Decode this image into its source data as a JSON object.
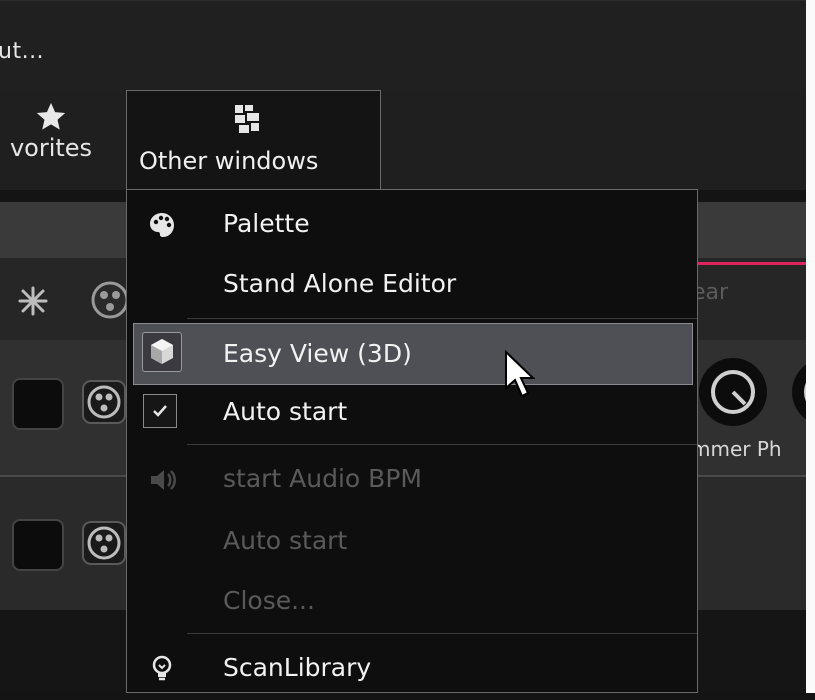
{
  "window": {
    "title": "ut..."
  },
  "ribbon": {
    "favorites_label": "vorites",
    "other_windows_label": "Other windows"
  },
  "background": {
    "clear_label": "ear",
    "knob_labels": "mmer  Ph"
  },
  "menu": {
    "items": [
      {
        "label": "Palette",
        "icon": "palette-icon",
        "enabled": true
      },
      {
        "label": "Stand Alone Editor",
        "icon": "",
        "enabled": true
      },
      {
        "label": "Easy View (3D)",
        "icon": "cube-3d-icon",
        "enabled": true,
        "highlighted": true
      },
      {
        "label": "Auto start",
        "icon": "checkbox-icon",
        "enabled": true,
        "checked": true
      },
      {
        "label": "start Audio BPM",
        "icon": "speaker-icon",
        "enabled": false
      },
      {
        "label": "Auto start",
        "icon": "",
        "enabled": false
      },
      {
        "label": "Close...",
        "icon": "",
        "enabled": false
      },
      {
        "label": "ScanLibrary",
        "icon": "lightbulb-icon",
        "enabled": true
      }
    ]
  },
  "colors": {
    "accent_red": "#e0245e",
    "menu_bg": "#0e0e0e",
    "highlight_bg": "#4f4f56"
  }
}
